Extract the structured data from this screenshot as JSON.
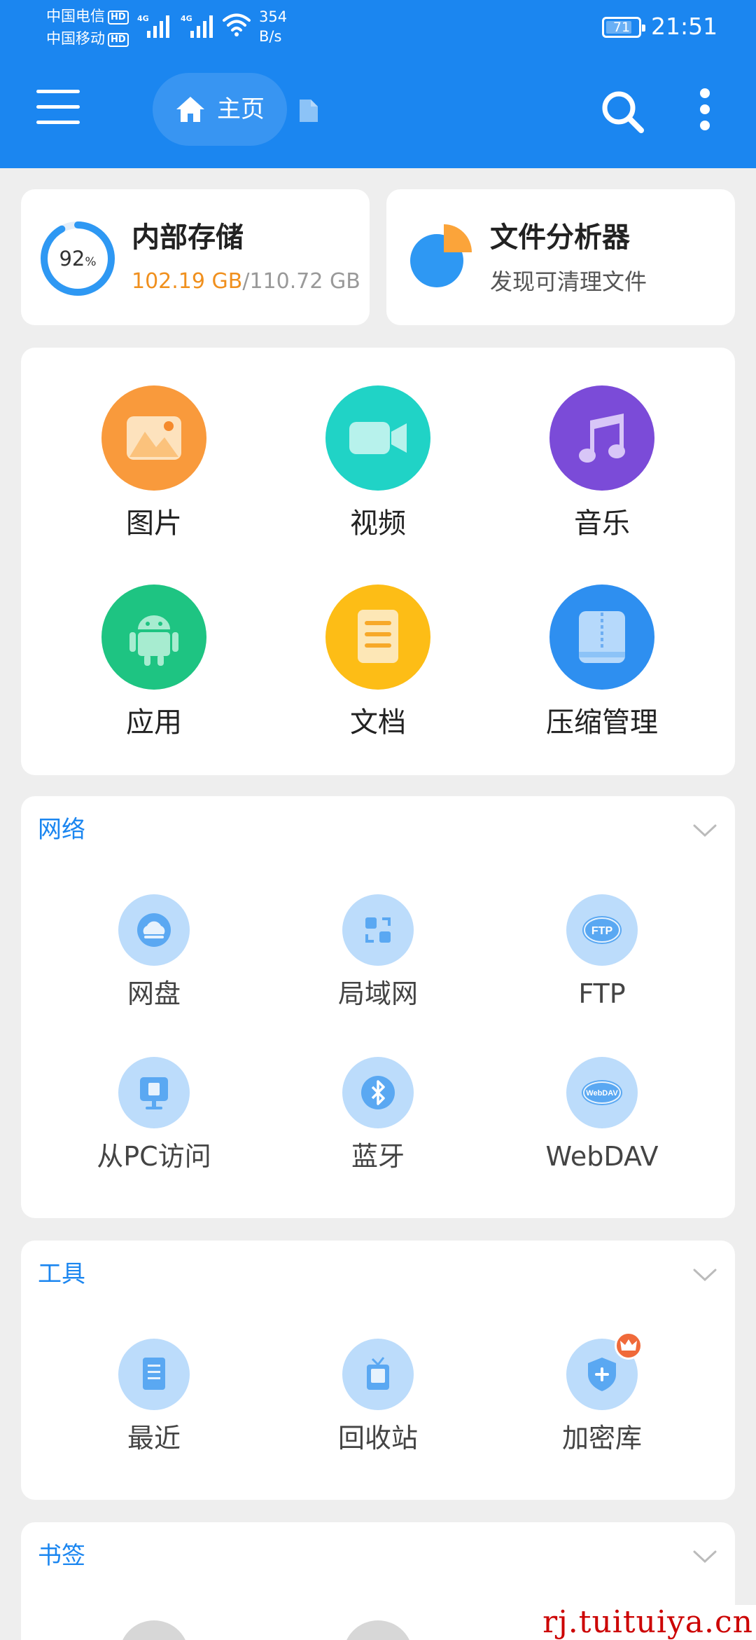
{
  "status_bar": {
    "carrier_1": "中国电信",
    "carrier_2": "中国移动",
    "hd_badge": "HD",
    "network_1": "4G",
    "network_2": "4G",
    "speed_value": "354",
    "speed_unit": "B/s",
    "battery": "71",
    "time": "21:51"
  },
  "header": {
    "home_label": "主页"
  },
  "storage": {
    "title": "内部存储",
    "percent": "92",
    "percent_unit": "%",
    "used": "102.19 GB",
    "total": "/110.72 GB",
    "used_fraction": 0.92
  },
  "analyzer": {
    "title": "文件分析器",
    "subtitle": "发现可清理文件"
  },
  "categories": [
    {
      "label": "图片",
      "icon": "image-icon",
      "color": "#f99a3c"
    },
    {
      "label": "视频",
      "icon": "video-icon",
      "color": "#20d3c6"
    },
    {
      "label": "音乐",
      "icon": "music-icon",
      "color": "#7b4bd8"
    },
    {
      "label": "应用",
      "icon": "android-icon",
      "color": "#1ec482"
    },
    {
      "label": "文档",
      "icon": "document-icon",
      "color": "#fdbd16"
    },
    {
      "label": "压缩管理",
      "icon": "archive-icon",
      "color": "#2e8ff0"
    }
  ],
  "network": {
    "title": "网络",
    "items": [
      {
        "label": "网盘",
        "icon": "cloud-drive-icon"
      },
      {
        "label": "局域网",
        "icon": "lan-icon"
      },
      {
        "label": "FTP",
        "icon": "ftp-icon",
        "badge": "FTP"
      },
      {
        "label": "从PC访问",
        "icon": "pc-access-icon"
      },
      {
        "label": "蓝牙",
        "icon": "bluetooth-icon"
      },
      {
        "label": "WebDAV",
        "icon": "webdav-icon",
        "badge": "WebDAV"
      }
    ]
  },
  "tools": {
    "title": "工具",
    "items": [
      {
        "label": "最近",
        "icon": "recent-icon"
      },
      {
        "label": "回收站",
        "icon": "recycle-bin-icon"
      },
      {
        "label": "加密库",
        "icon": "vault-icon"
      }
    ]
  },
  "bookmarks": {
    "title": "书签"
  },
  "watermark": "rj.tuituiya.cn",
  "colors": {
    "accent": "#1b86f0",
    "storage_used": "#f0901e",
    "icon_bg_light": "#bcdcfb",
    "icon_fg": "#5aa8f2"
  }
}
